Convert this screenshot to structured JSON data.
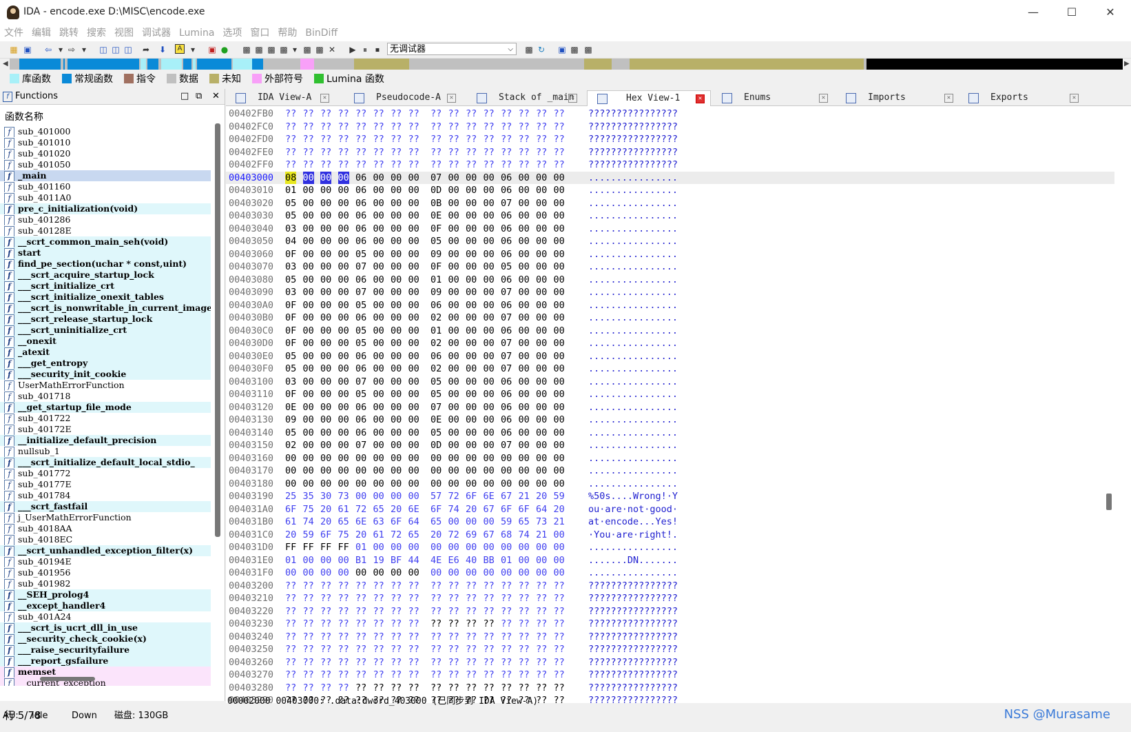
{
  "window": {
    "title": "IDA - encode.exe D:\\MISC\\encode.exe"
  },
  "menu": [
    "文件",
    "编辑",
    "跳转",
    "搜索",
    "视图",
    "调试器",
    "Lumina",
    "选项",
    "窗口",
    "帮助",
    "BinDiff"
  ],
  "toolbar": {
    "debugger_select": "无调试器"
  },
  "legend": [
    {
      "label": "库函数",
      "color": "#a8f0f8"
    },
    {
      "label": "常规函数",
      "color": "#0a8ad8"
    },
    {
      "label": "指令",
      "color": "#a07060"
    },
    {
      "label": "数据",
      "color": "#c0c0c0"
    },
    {
      "label": "未知",
      "color": "#b8b068"
    },
    {
      "label": "外部符号",
      "color": "#f8a0f8"
    },
    {
      "label": "Lumina 函数",
      "color": "#30c030"
    }
  ],
  "functions": {
    "header": "Functions",
    "column": "函数名称",
    "status": "行 5/78",
    "items": [
      {
        "name": "sub_401000",
        "kind": "reg"
      },
      {
        "name": "sub_401010",
        "kind": "reg"
      },
      {
        "name": "sub_401020",
        "kind": "reg"
      },
      {
        "name": "sub_401050",
        "kind": "reg"
      },
      {
        "name": "_main",
        "kind": "sel"
      },
      {
        "name": "sub_401160",
        "kind": "reg"
      },
      {
        "name": "sub_4011A0",
        "kind": "reg"
      },
      {
        "name": "pre_c_initialization(void)",
        "kind": "lib"
      },
      {
        "name": "sub_401286",
        "kind": "reg"
      },
      {
        "name": "sub_40128E",
        "kind": "reg"
      },
      {
        "name": "__scrt_common_main_seh(void)",
        "kind": "lib"
      },
      {
        "name": "start",
        "kind": "lib"
      },
      {
        "name": "find_pe_section(uchar * const,uint)",
        "kind": "lib"
      },
      {
        "name": "___scrt_acquire_startup_lock",
        "kind": "lib"
      },
      {
        "name": "___scrt_initialize_crt",
        "kind": "lib"
      },
      {
        "name": "___scrt_initialize_onexit_tables",
        "kind": "lib"
      },
      {
        "name": "___scrt_is_nonwritable_in_current_image",
        "kind": "lib"
      },
      {
        "name": "___scrt_release_startup_lock",
        "kind": "lib"
      },
      {
        "name": "___scrt_uninitialize_crt",
        "kind": "lib"
      },
      {
        "name": "__onexit",
        "kind": "libb"
      },
      {
        "name": "_atexit",
        "kind": "libb"
      },
      {
        "name": "___get_entropy",
        "kind": "lib"
      },
      {
        "name": "___security_init_cookie",
        "kind": "libb"
      },
      {
        "name": "UserMathErrorFunction",
        "kind": "reg"
      },
      {
        "name": "sub_401718",
        "kind": "reg"
      },
      {
        "name": "__get_startup_file_mode",
        "kind": "lib"
      },
      {
        "name": "sub_401722",
        "kind": "reg"
      },
      {
        "name": "sub_40172E",
        "kind": "reg"
      },
      {
        "name": "__initialize_default_precision",
        "kind": "lib"
      },
      {
        "name": "nullsub_1",
        "kind": "reg"
      },
      {
        "name": "___scrt_initialize_default_local_stdio_",
        "kind": "lib"
      },
      {
        "name": "sub_401772",
        "kind": "reg"
      },
      {
        "name": "sub_40177E",
        "kind": "reg"
      },
      {
        "name": "sub_401784",
        "kind": "reg"
      },
      {
        "name": "___scrt_fastfail",
        "kind": "lib"
      },
      {
        "name": "j_UserMathErrorFunction",
        "kind": "reg"
      },
      {
        "name": "sub_4018AA",
        "kind": "reg"
      },
      {
        "name": "sub_4018EC",
        "kind": "reg"
      },
      {
        "name": "__scrt_unhandled_exception_filter(x)",
        "kind": "lib"
      },
      {
        "name": "sub_40194E",
        "kind": "reg"
      },
      {
        "name": "sub_401956",
        "kind": "reg"
      },
      {
        "name": "sub_401982",
        "kind": "reg"
      },
      {
        "name": "__SEH_prolog4",
        "kind": "lib"
      },
      {
        "name": "__except_handler4",
        "kind": "lib"
      },
      {
        "name": "sub_401A24",
        "kind": "reg"
      },
      {
        "name": "___scrt_is_ucrt_dll_in_use",
        "kind": "lib"
      },
      {
        "name": "__security_check_cookie(x)",
        "kind": "libb"
      },
      {
        "name": "___raise_securityfailure",
        "kind": "lib"
      },
      {
        "name": "___report_gsfailure",
        "kind": "libb"
      },
      {
        "name": "memset",
        "kind": "extb"
      },
      {
        "name": "__current_exception",
        "kind": "ext"
      }
    ]
  },
  "tabs": [
    {
      "label": "IDA View-A",
      "active": false
    },
    {
      "label": "Pseudocode-A",
      "active": false
    },
    {
      "label": "Stack of _main",
      "active": false
    },
    {
      "label": "Hex View-1",
      "active": true
    },
    {
      "label": "Enums",
      "active": false
    },
    {
      "label": "Imports",
      "active": false
    },
    {
      "label": "Exports",
      "active": false
    }
  ],
  "hex": {
    "rows": [
      {
        "addr": "00402FB0",
        "bytes": "?? ?? ?? ?? ?? ?? ?? ?? ?? ?? ?? ?? ?? ?? ?? ??",
        "ascii": "????????????????"
      },
      {
        "addr": "00402FC0",
        "bytes": "?? ?? ?? ?? ?? ?? ?? ?? ?? ?? ?? ?? ?? ?? ?? ??",
        "ascii": "????????????????"
      },
      {
        "addr": "00402FD0",
        "bytes": "?? ?? ?? ?? ?? ?? ?? ?? ?? ?? ?? ?? ?? ?? ?? ??",
        "ascii": "????????????????"
      },
      {
        "addr": "00402FE0",
        "bytes": "?? ?? ?? ?? ?? ?? ?? ?? ?? ?? ?? ?? ?? ?? ?? ??",
        "ascii": "????????????????"
      },
      {
        "addr": "00402FF0",
        "bytes": "?? ?? ?? ?? ?? ?? ?? ?? ?? ?? ?? ?? ?? ?? ?? ??",
        "ascii": "????????????????"
      },
      {
        "addr": "00403000",
        "bytes": "08 00 00 00 06 00 00 00 07 00 00 00 06 00 00 00",
        "ascii": "................",
        "current": true
      },
      {
        "addr": "00403010",
        "bytes": "01 00 00 00 06 00 00 00 0D 00 00 00 06 00 00 00",
        "ascii": "................"
      },
      {
        "addr": "00403020",
        "bytes": "05 00 00 00 06 00 00 00 0B 00 00 00 07 00 00 00",
        "ascii": "................"
      },
      {
        "addr": "00403030",
        "bytes": "05 00 00 00 06 00 00 00 0E 00 00 00 06 00 00 00",
        "ascii": "................"
      },
      {
        "addr": "00403040",
        "bytes": "03 00 00 00 06 00 00 00 0F 00 00 00 06 00 00 00",
        "ascii": "................"
      },
      {
        "addr": "00403050",
        "bytes": "04 00 00 00 06 00 00 00 05 00 00 00 06 00 00 00",
        "ascii": "................"
      },
      {
        "addr": "00403060",
        "bytes": "0F 00 00 00 05 00 00 00 09 00 00 00 06 00 00 00",
        "ascii": "................"
      },
      {
        "addr": "00403070",
        "bytes": "03 00 00 00 07 00 00 00 0F 00 00 00 05 00 00 00",
        "ascii": "................"
      },
      {
        "addr": "00403080",
        "bytes": "05 00 00 00 06 00 00 00 01 00 00 00 06 00 00 00",
        "ascii": "................"
      },
      {
        "addr": "00403090",
        "bytes": "03 00 00 00 07 00 00 00 09 00 00 00 07 00 00 00",
        "ascii": "................"
      },
      {
        "addr": "004030A0",
        "bytes": "0F 00 00 00 05 00 00 00 06 00 00 00 06 00 00 00",
        "ascii": "................"
      },
      {
        "addr": "004030B0",
        "bytes": "0F 00 00 00 06 00 00 00 02 00 00 00 07 00 00 00",
        "ascii": "................"
      },
      {
        "addr": "004030C0",
        "bytes": "0F 00 00 00 05 00 00 00 01 00 00 00 06 00 00 00",
        "ascii": "................"
      },
      {
        "addr": "004030D0",
        "bytes": "0F 00 00 00 05 00 00 00 02 00 00 00 07 00 00 00",
        "ascii": "................"
      },
      {
        "addr": "004030E0",
        "bytes": "05 00 00 00 06 00 00 00 06 00 00 00 07 00 00 00",
        "ascii": "................"
      },
      {
        "addr": "004030F0",
        "bytes": "05 00 00 00 06 00 00 00 02 00 00 00 07 00 00 00",
        "ascii": "................"
      },
      {
        "addr": "00403100",
        "bytes": "03 00 00 00 07 00 00 00 05 00 00 00 06 00 00 00",
        "ascii": "................"
      },
      {
        "addr": "00403110",
        "bytes": "0F 00 00 00 05 00 00 00 05 00 00 00 06 00 00 00",
        "ascii": "................"
      },
      {
        "addr": "00403120",
        "bytes": "0E 00 00 00 06 00 00 00 07 00 00 00 06 00 00 00",
        "ascii": "................"
      },
      {
        "addr": "00403130",
        "bytes": "09 00 00 00 06 00 00 00 0E 00 00 00 06 00 00 00",
        "ascii": "................"
      },
      {
        "addr": "00403140",
        "bytes": "05 00 00 00 06 00 00 00 05 00 00 00 06 00 00 00",
        "ascii": "................"
      },
      {
        "addr": "00403150",
        "bytes": "02 00 00 00 07 00 00 00 0D 00 00 00 07 00 00 00",
        "ascii": "................"
      },
      {
        "addr": "00403160",
        "bytes": "00 00 00 00 00 00 00 00 00 00 00 00 00 00 00 00",
        "ascii": "................"
      },
      {
        "addr": "00403170",
        "bytes": "00 00 00 00 00 00 00 00 00 00 00 00 00 00 00 00",
        "ascii": "................"
      },
      {
        "addr": "00403180",
        "bytes": "00 00 00 00 00 00 00 00 00 00 00 00 00 00 00 00",
        "ascii": "................"
      },
      {
        "addr": "00403190",
        "bytes": "25 35 30 73 00 00 00 00 57 72 6F 6E 67 21 20 59",
        "ascii": "%50s....Wrong!·Y",
        "blue": true
      },
      {
        "addr": "004031A0",
        "bytes": "6F 75 20 61 72 65 20 6E 6F 74 20 67 6F 6F 64 20",
        "ascii": "ou·are·not·good·",
        "blue": true
      },
      {
        "addr": "004031B0",
        "bytes": "61 74 20 65 6E 63 6F 64 65 00 00 00 59 65 73 21",
        "ascii": "at·encode...Yes!",
        "blue": true
      },
      {
        "addr": "004031C0",
        "bytes": "20 59 6F 75 20 61 72 65 20 72 69 67 68 74 21 00",
        "ascii": "·You·are·right!.",
        "blue": true
      },
      {
        "addr": "004031D0",
        "bytes": "FF FF FF FF 01 00 00 00 00 00 00 00 00 00 00 00",
        "ascii": "................",
        "mix": 4
      },
      {
        "addr": "004031E0",
        "bytes": "01 00 00 00 B1 19 BF 44 4E E6 40 BB 01 00 00 00",
        "ascii": ".......DN.......",
        "blue": true
      },
      {
        "addr": "004031F0",
        "bytes": "00 00 00 00 00 00 00 00 00 00 00 00 00 00 00 00",
        "ascii": "................",
        "mixblk": true
      },
      {
        "addr": "00403200",
        "bytes": "?? ?? ?? ?? ?? ?? ?? ?? ?? ?? ?? ?? ?? ?? ?? ??",
        "ascii": "????????????????"
      },
      {
        "addr": "00403210",
        "bytes": "?? ?? ?? ?? ?? ?? ?? ?? ?? ?? ?? ?? ?? ?? ?? ??",
        "ascii": "????????????????"
      },
      {
        "addr": "00403220",
        "bytes": "?? ?? ?? ?? ?? ?? ?? ?? ?? ?? ?? ?? ?? ?? ?? ??",
        "ascii": "????????????????"
      },
      {
        "addr": "00403230",
        "bytes": "?? ?? ?? ?? ?? ?? ?? ?? ?? ?? ?? ?? ?? ?? ?? ??",
        "ascii": "????????????????",
        "blk": [
          8,
          9,
          10,
          11
        ]
      },
      {
        "addr": "00403240",
        "bytes": "?? ?? ?? ?? ?? ?? ?? ?? ?? ?? ?? ?? ?? ?? ?? ??",
        "ascii": "????????????????"
      },
      {
        "addr": "00403250",
        "bytes": "?? ?? ?? ?? ?? ?? ?? ?? ?? ?? ?? ?? ?? ?? ?? ??",
        "ascii": "????????????????"
      },
      {
        "addr": "00403260",
        "bytes": "?? ?? ?? ?? ?? ?? ?? ?? ?? ?? ?? ?? ?? ?? ?? ??",
        "ascii": "????????????????"
      },
      {
        "addr": "00403270",
        "bytes": "?? ?? ?? ?? ?? ?? ?? ?? ?? ?? ?? ?? ?? ?? ?? ??",
        "ascii": "????????????????"
      },
      {
        "addr": "00403280",
        "bytes": "?? ?? ?? ?? ?? ?? ?? ?? ?? ?? ?? ?? ?? ?? ?? ??",
        "ascii": "????????????????",
        "blk": [
          4,
          5,
          6,
          7,
          8,
          9,
          10,
          11,
          12,
          13,
          14,
          15
        ]
      },
      {
        "addr": "00403290",
        "bytes": "?? ?? ?? ?? ?? ?? ?? ?? ?? ?? ?? ?? ?? ?? ?? ??",
        "ascii": "????????????????",
        "blk": [
          0,
          1,
          2,
          3,
          4,
          5,
          6,
          7,
          8,
          9,
          10,
          11,
          12,
          13,
          14,
          15
        ]
      }
    ],
    "status": "00002000 00403000: .data:dword_403000 (已同步到 IDA View-A)"
  },
  "statusbar": {
    "au_label": "AU:",
    "au_state": "idle",
    "direction": "Down",
    "disk": "磁盘: 130GB"
  },
  "watermark": "NSS @Murasame"
}
